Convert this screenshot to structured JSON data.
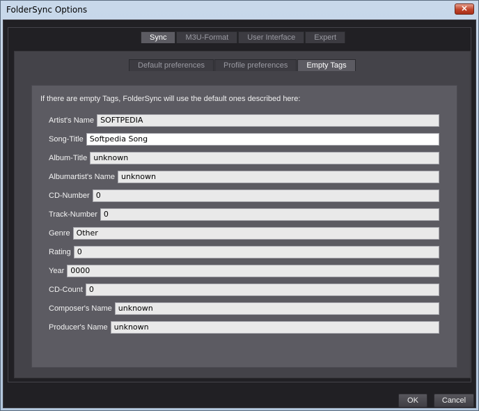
{
  "window": {
    "title": "FolderSync Options",
    "close_label": "✕"
  },
  "main_tabs": [
    {
      "label": "Sync",
      "active": true
    },
    {
      "label": "M3U-Format",
      "active": false
    },
    {
      "label": "User Interface",
      "active": false
    },
    {
      "label": "Expert",
      "active": false
    }
  ],
  "sub_tabs": [
    {
      "label": "Default preferences",
      "active": false
    },
    {
      "label": "Profile preferences",
      "active": false
    },
    {
      "label": "Empty Tags",
      "active": true
    }
  ],
  "intro_text": "If there are empty Tags, FolderSync will use the default ones described here:",
  "fields": [
    {
      "label": "Artist's Name",
      "value": "SOFTPEDIA"
    },
    {
      "label": "Song-Title",
      "value": "Softpedia Song"
    },
    {
      "label": "Album-Title",
      "value": "unknown"
    },
    {
      "label": "Albumartist's Name",
      "value": "unknown"
    },
    {
      "label": "CD-Number",
      "value": "0"
    },
    {
      "label": "Track-Number",
      "value": "0"
    },
    {
      "label": "Genre",
      "value": "Other"
    },
    {
      "label": "Rating",
      "value": "0"
    },
    {
      "label": "Year",
      "value": "0000"
    },
    {
      "label": "CD-Count",
      "value": "0"
    },
    {
      "label": "Composer's Name",
      "value": "unknown"
    },
    {
      "label": "Producer's Name",
      "value": "unknown"
    }
  ],
  "buttons": {
    "ok": "OK",
    "cancel": "Cancel"
  }
}
